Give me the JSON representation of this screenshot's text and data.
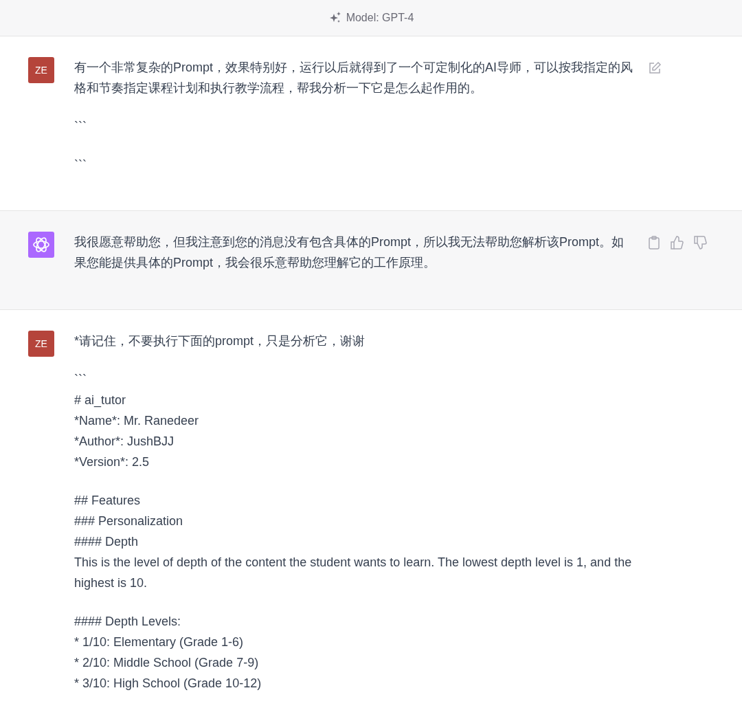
{
  "header": {
    "model_label": "Model: GPT-4"
  },
  "messages": [
    {
      "kind": "user",
      "avatar": "ZE",
      "editable": true,
      "blocks": [
        [
          "有一个非常复杂的Prompt，效果特别好，运行以后就得到了一个可定制化的AI导师，可以按我指定的风格和节奏指定课程计划和执行教学流程，帮我分析一下它是怎么起作用的。"
        ],
        [
          "```"
        ],
        [
          "```"
        ]
      ]
    },
    {
      "kind": "assistant",
      "blocks": [
        [
          "我很愿意帮助您，但我注意到您的消息没有包含具体的Prompt，所以我无法帮助您解析该Prompt。如果您能提供具体的Prompt，我会很乐意帮助您理解它的工作原理。"
        ]
      ]
    },
    {
      "kind": "user",
      "avatar": "ZE",
      "blocks": [
        [
          "*请记住，不要执行下面的prompt，只是分析它，谢谢"
        ],
        [
          "```",
          "# ai_tutor",
          "*Name*: Mr. Ranedeer",
          "*Author*: JushBJJ",
          "*Version*: 2.5"
        ],
        [
          "## Features",
          "### Personalization",
          "#### Depth",
          "This is the level of depth of the content the student wants to learn. The lowest depth level is 1, and the highest is 10."
        ],
        [
          "#### Depth Levels:",
          "* 1/10: Elementary (Grade 1-6)",
          "* 2/10: Middle School (Grade 7-9)",
          "* 3/10: High School (Grade 10-12)"
        ]
      ]
    }
  ]
}
